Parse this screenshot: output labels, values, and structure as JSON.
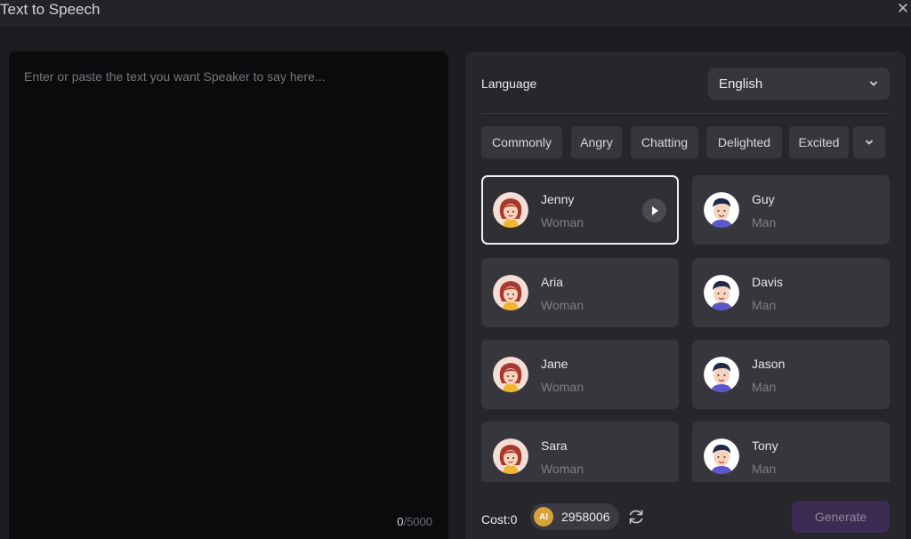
{
  "window": {
    "title": "Text to Speech",
    "close_glyph": "✕"
  },
  "editor": {
    "placeholder": "Enter or paste the text you want Speaker to say here...",
    "char_count": "0",
    "char_max": "/5000"
  },
  "language": {
    "label": "Language",
    "value": "English"
  },
  "tags": [
    "Commonly",
    "Angry",
    "Chatting",
    "Delighted",
    "Excited"
  ],
  "voices": [
    {
      "name": "Jenny",
      "gender": "Woman",
      "type": "woman",
      "selected": true
    },
    {
      "name": "Guy",
      "gender": "Man",
      "type": "man",
      "selected": false
    },
    {
      "name": "Aria",
      "gender": "Woman",
      "type": "woman",
      "selected": false
    },
    {
      "name": "Davis",
      "gender": "Man",
      "type": "man",
      "selected": false
    },
    {
      "name": "Jane",
      "gender": "Woman",
      "type": "woman",
      "selected": false
    },
    {
      "name": "Jason",
      "gender": "Man",
      "type": "man",
      "selected": false
    },
    {
      "name": "Sara",
      "gender": "Woman",
      "type": "woman",
      "selected": false
    },
    {
      "name": "Tony",
      "gender": "Man",
      "type": "man",
      "selected": false
    }
  ],
  "footer": {
    "cost_label": "Cost:0",
    "coin_label": "AI",
    "credits": "2958006",
    "generate_label": "Generate"
  },
  "colors": {
    "accent": "#3a2c52",
    "coin": "#d9a23a",
    "selected_border": "#f0f0f3"
  },
  "icons": [
    "close-icon",
    "chevron-down-icon",
    "play-icon",
    "refresh-icon",
    "coin-icon"
  ]
}
